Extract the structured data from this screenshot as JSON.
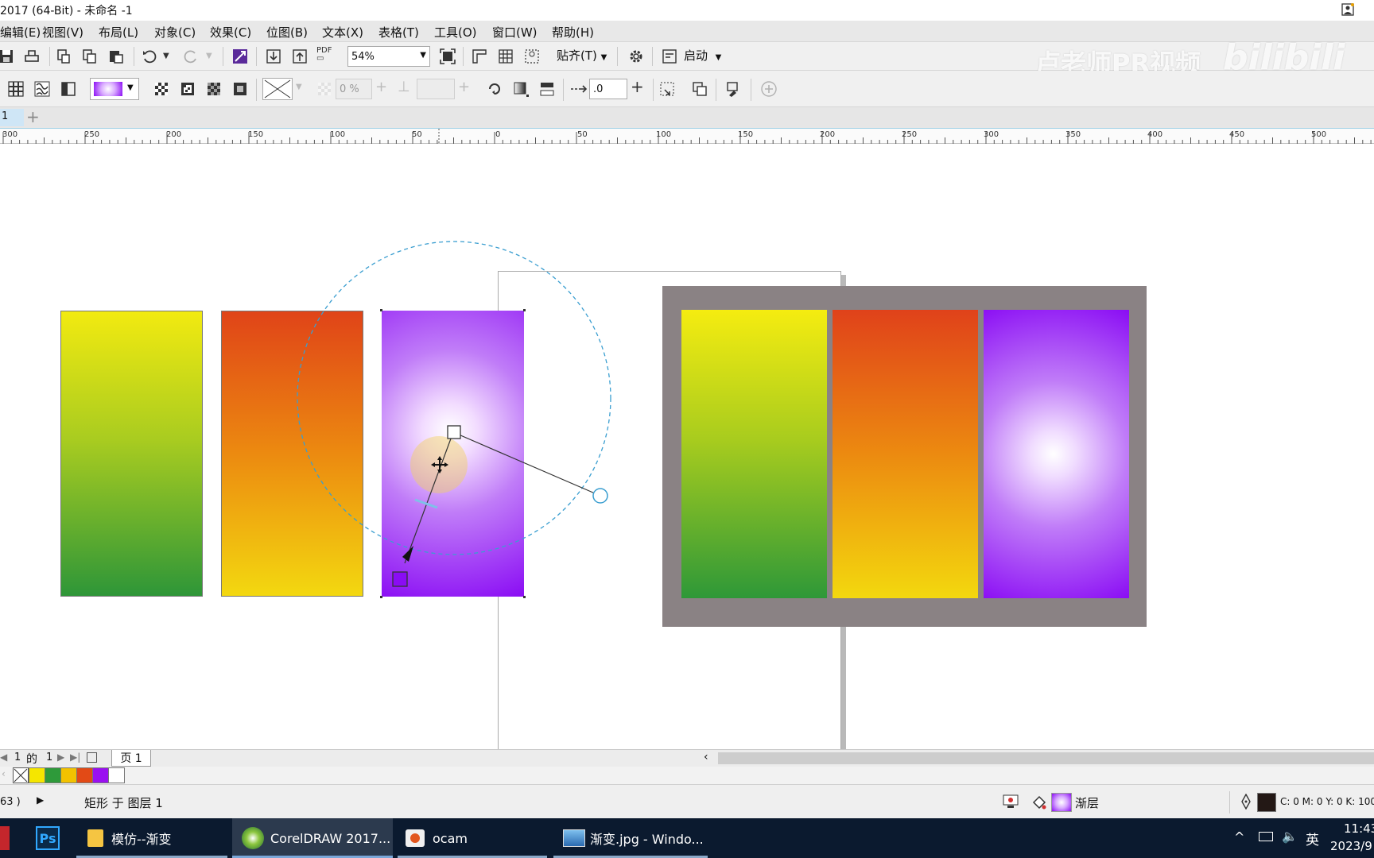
{
  "window": {
    "title": "2017 (64-Bit) - 未命名 -1"
  },
  "menu": [
    "编辑(E)",
    "视图(V)",
    "布局(L)",
    "对象(C)",
    "效果(C)",
    "位图(B)",
    "文本(X)",
    "表格(T)",
    "工具(O)",
    "窗口(W)",
    "帮助(H)"
  ],
  "toolbar": {
    "pdf_label": "PDF",
    "zoom": "54%",
    "snap_label": "贴齐(T)",
    "launch_label": "启动"
  },
  "watermark": {
    "text": "卢老师PR视频",
    "logo": "bilibili"
  },
  "property_bar": {
    "transparency": "0 %",
    "offset": ".0"
  },
  "tabs": {
    "first": "1"
  },
  "ruler_labels": [
    "300",
    "250",
    "200",
    "150",
    "100",
    "50",
    "0",
    "50",
    "100",
    "150",
    "200",
    "250",
    "300",
    "350",
    "400",
    "450",
    "500"
  ],
  "page_nav": {
    "current": "1",
    "of": "的",
    "total": "1",
    "page_tab": "页 1"
  },
  "palette_colors": [
    "#f5e600",
    "#2e9a3a",
    "#f2c200",
    "#e24a16",
    "#9a10f0",
    "#ffffff"
  ],
  "status": {
    "coords": "63 )",
    "object_info": "矩形 于 图层 1",
    "fill_label": "渐层",
    "color_info": "C: 0 M: 0 Y: 0 K: 100"
  },
  "colors": {
    "yellow": "#f2ea10",
    "green": "#2e9638",
    "red_orange": "#e04418",
    "gold": "#f3d810",
    "purple": "#8a0cf4",
    "frame_gray": "#8a8284"
  },
  "taskbar": {
    "items": [
      "模仿--渐变",
      "CorelDRAW 2017...",
      "ocam",
      "渐变.jpg - Windo..."
    ],
    "ps_label": "Ps",
    "ime": "英",
    "time": "11:43",
    "date": "2023/9"
  }
}
